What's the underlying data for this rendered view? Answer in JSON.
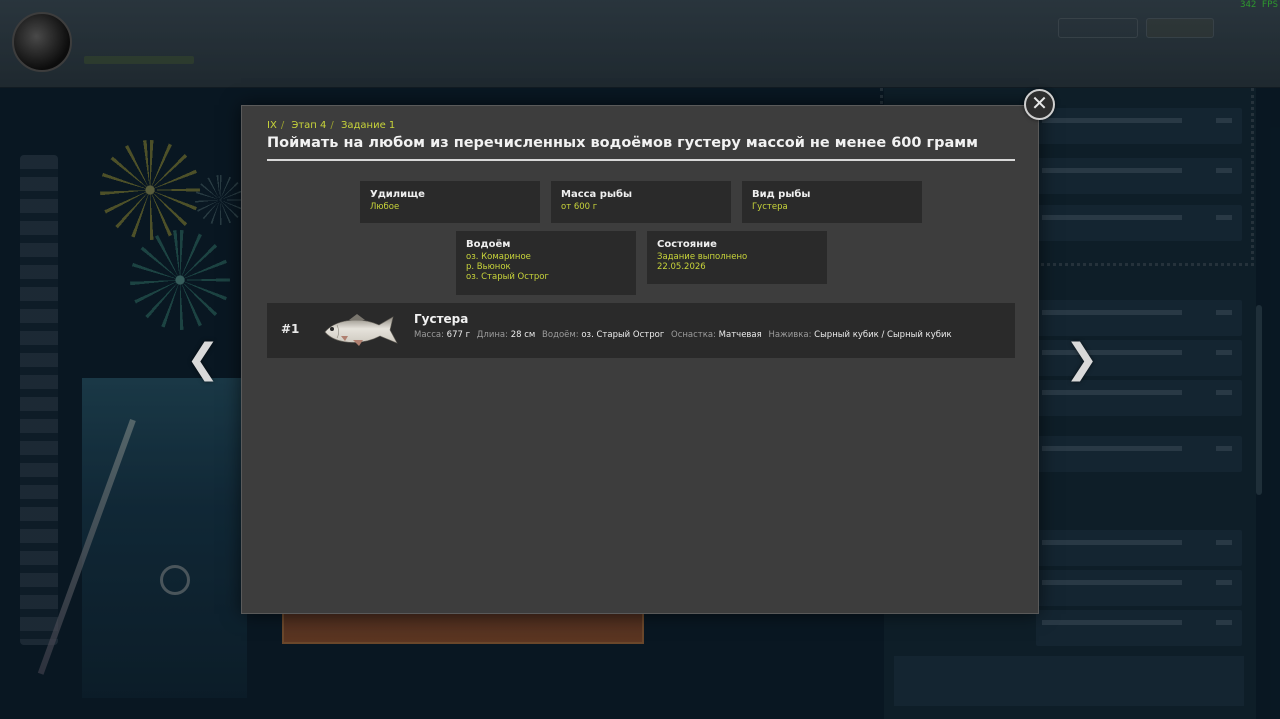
{
  "hud": {
    "fps": "342 FPS"
  },
  "modal": {
    "breadcrumb": [
      "IX",
      "Этап 4",
      "Задание 1"
    ],
    "breadcrumb_separator": "/",
    "title": "Поймать на любом из перечисленных водоёмов густеру массой не менее 600 грамм",
    "info_cards": {
      "rod": {
        "label": "Удилище",
        "values": [
          "Любое"
        ]
      },
      "fish_mass": {
        "label": "Масса рыбы",
        "values": [
          "от 600 г"
        ]
      },
      "fish_type": {
        "label": "Вид рыбы",
        "values": [
          "Густера"
        ]
      },
      "waterbody": {
        "label": "Водоём",
        "values": [
          "оз. Комариное",
          "р. Вьюнок",
          "оз. Старый Острог"
        ]
      },
      "status": {
        "label": "Состояние",
        "values": [
          "Задание выполнено",
          "22.05.2026"
        ]
      }
    },
    "catch": {
      "number": "#1",
      "fish_name": "Густера",
      "stats": [
        {
          "label": "Масса:",
          "value": "677 г"
        },
        {
          "label": "Длина:",
          "value": "28 см"
        },
        {
          "label": "Водоём:",
          "value": "оз. Старый Острог"
        },
        {
          "label": "Оснастка:",
          "value": "Матчевая"
        },
        {
          "label": "Наживка:",
          "value": "Сырный кубик / Сырный кубик"
        }
      ]
    }
  },
  "colors": {
    "accent_yellow": "#c8d43a",
    "modal_bg": "#3d3d3d",
    "card_bg": "#2a2a2a"
  },
  "icons": {
    "close": "close-icon",
    "prev": "chevron-left-icon",
    "next": "chevron-right-icon"
  }
}
